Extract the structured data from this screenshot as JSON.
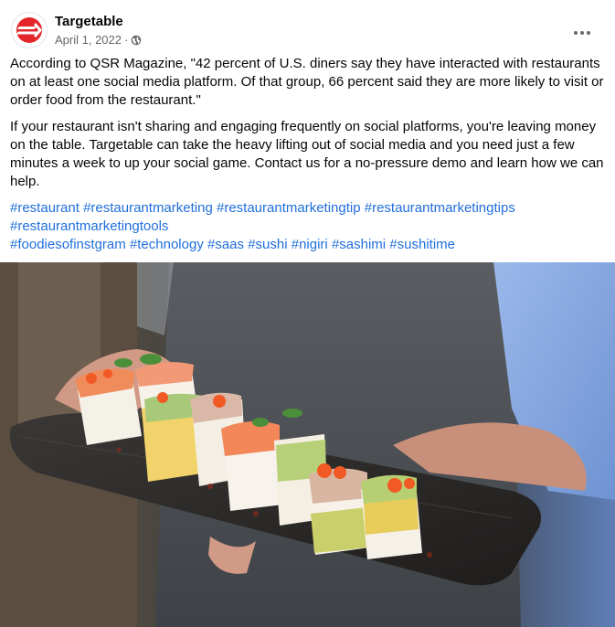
{
  "post": {
    "author": "Targetable",
    "date": "April 1, 2022",
    "separator": "·",
    "audience_icon": "globe-icon",
    "more_icon": "more-options-icon",
    "paragraphs": [
      "According to QSR Magazine, \"42 percent of U.S. diners say they have interacted with restaurants on at least one social media platform. Of that group, 66 percent said they are more likely to visit or order food from the restaurant.\"",
      "If your restaurant isn't sharing and engaging frequently on social platforms, you're leaving money on the table. Targetable can take the heavy lifting out of social media and you need just a few minutes a week to up your social game. Contact us for a no-pressure demo and learn how we can help."
    ],
    "hashtag_lines": [
      [
        "#restaurant",
        "#restaurantmarketing",
        "#restaurantmarketingtip",
        "#restaurantmarketingtips"
      ],
      [
        "#restaurantmarketingtools"
      ],
      [
        "#foodiesofinstgram",
        "#technology",
        "#saas",
        "#sushi",
        "#nigiri",
        "#sashimi",
        "#sushitime"
      ]
    ],
    "link_color": "#216fdb",
    "brand_color": "#e4262b"
  }
}
